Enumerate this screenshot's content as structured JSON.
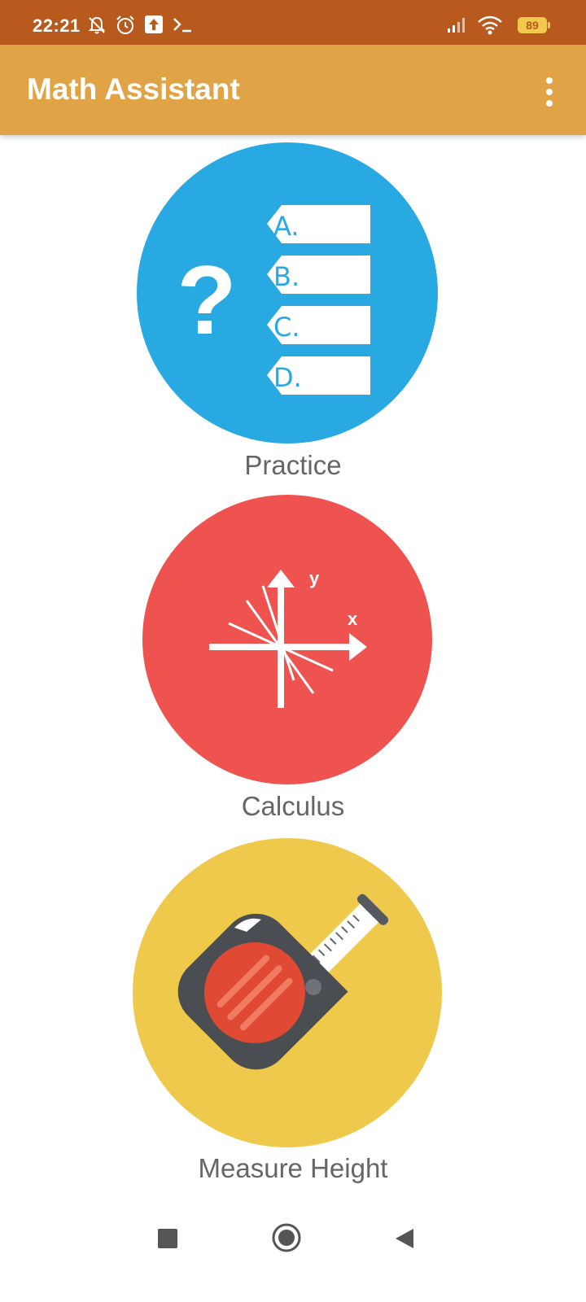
{
  "status_bar": {
    "time": "22:21",
    "battery": "89",
    "icons": [
      "notifications-off-icon",
      "alarm-icon",
      "upload-icon",
      "terminal-icon",
      "signal-icon",
      "wifi-icon",
      "battery-icon"
    ]
  },
  "app_bar": {
    "title": "Math Assistant",
    "menu_icon": "more-vert-icon",
    "color": "#e0a447"
  },
  "menu": [
    {
      "label": "Practice",
      "icon": "multiple-choice-icon",
      "color": "#29a9e1",
      "choices": [
        "A.",
        "B.",
        "C.",
        "D."
      ]
    },
    {
      "label": "Calculus",
      "icon": "graph-axes-icon",
      "color": "#ef5350",
      "axis_x": "x",
      "axis_y": "y"
    },
    {
      "label": "Measure Height",
      "icon": "tape-measure-icon",
      "color": "#efc94c"
    }
  ],
  "nav_bar": {
    "icons": [
      "recents-square-icon",
      "home-circle-icon",
      "back-triangle-icon"
    ]
  }
}
